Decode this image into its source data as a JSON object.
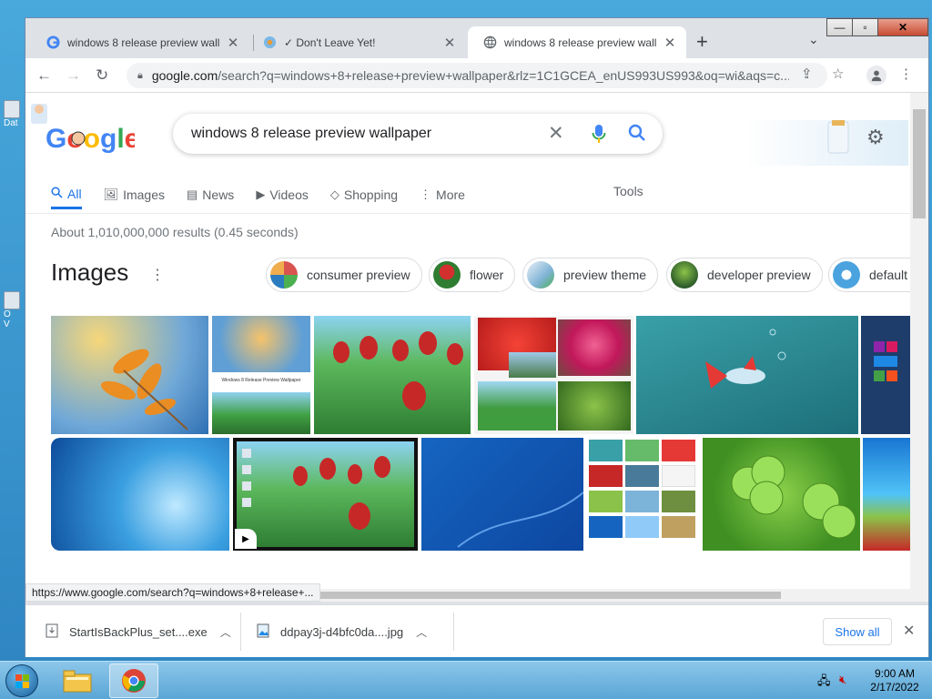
{
  "desktop": {
    "icons": [
      {
        "label": "Dat"
      },
      {
        "label": "O\nV"
      }
    ]
  },
  "browser": {
    "tabs": [
      {
        "title": "windows 8 release preview wallpaper",
        "active": false
      },
      {
        "title": "✓ Don't Leave Yet!",
        "active": false
      },
      {
        "title": "windows 8 release preview wallpaper",
        "active": true
      }
    ],
    "url_host": "google.com",
    "url_rest": "/search?q=windows+8+release+preview+wallpaper&rlz=1C1GCEA_enUS993US993&oq=wi&aqs=c...",
    "status_url": "https://www.google.com/search?q=windows+8+release+..."
  },
  "google": {
    "query": "windows 8 release preview wallpaper",
    "nav": [
      {
        "label": "All",
        "icon": "search-icon"
      },
      {
        "label": "Images",
        "icon": "image-icon"
      },
      {
        "label": "News",
        "icon": "news-icon"
      },
      {
        "label": "Videos",
        "icon": "video-icon"
      },
      {
        "label": "Shopping",
        "icon": "tag-icon"
      },
      {
        "label": "More",
        "icon": "kebab-icon"
      }
    ],
    "tools": "Tools",
    "result_stats": "About 1,010,000,000 results (0.45 seconds)",
    "images_heading": "Images",
    "chips": [
      {
        "label": "consumer preview"
      },
      {
        "label": "flower"
      },
      {
        "label": "preview theme"
      },
      {
        "label": "developer preview"
      },
      {
        "label": "default"
      }
    ],
    "thumb_caption": "Windows 8 Release Preview Wallpaper"
  },
  "downloads": {
    "items": [
      {
        "name": "StartIsBackPlus_set....exe"
      },
      {
        "name": "ddpay3j-d4bfc0da....jpg"
      }
    ],
    "show_all": "Show all"
  },
  "taskbar": {
    "time": "9:00 AM",
    "date": "2/17/2022"
  },
  "colors": {
    "accent": "#1a73e8",
    "desktop": "#3a96c9"
  }
}
